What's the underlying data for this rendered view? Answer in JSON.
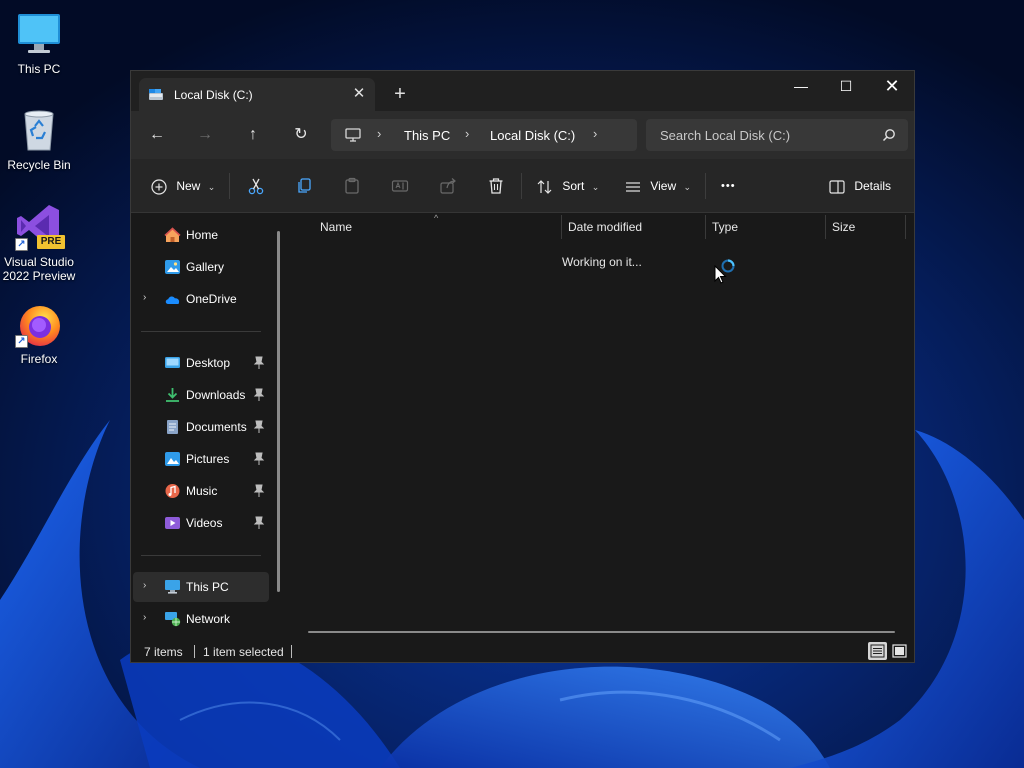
{
  "desktop": {
    "icons": [
      {
        "label": "This PC",
        "icon": "monitor-icon"
      },
      {
        "label": "Recycle Bin",
        "icon": "recycle-bin-icon"
      },
      {
        "label": "Visual Studio 2022 Preview",
        "icon": "visual-studio-icon",
        "badge": "PRE"
      },
      {
        "label": "Firefox",
        "icon": "firefox-icon"
      }
    ]
  },
  "window": {
    "tab": {
      "title": "Local Disk (C:)",
      "close": "✕",
      "new_tab": "+"
    },
    "controls": {
      "minimize": "—",
      "maximize": "☐",
      "close": "✕"
    },
    "nav": {
      "back": "←",
      "forward": "→",
      "up": "↑",
      "refresh": "↻",
      "breadcrumb": [
        "This PC",
        "Local Disk (C:)"
      ],
      "sep": "›",
      "search_placeholder": "Search Local Disk (C:)"
    },
    "toolbar": {
      "new_label": "New",
      "sort_label": "Sort",
      "view_label": "View",
      "more_label": "•••",
      "details_label": "Details",
      "chevron": "⌄"
    },
    "sidebar": {
      "top_items": [
        {
          "label": "Home",
          "icon": "home-icon"
        },
        {
          "label": "Gallery",
          "icon": "gallery-icon"
        },
        {
          "label": "OneDrive",
          "icon": "cloud-icon",
          "expander": "›"
        }
      ],
      "pinned_items": [
        {
          "label": "Desktop",
          "icon": "desktop-folder-icon"
        },
        {
          "label": "Downloads",
          "icon": "download-icon"
        },
        {
          "label": "Documents",
          "icon": "document-icon"
        },
        {
          "label": "Pictures",
          "icon": "pictures-icon"
        },
        {
          "label": "Music",
          "icon": "music-icon"
        },
        {
          "label": "Videos",
          "icon": "videos-icon"
        }
      ],
      "bottom_items": [
        {
          "label": "This PC",
          "icon": "monitor-icon",
          "expander": "›",
          "selected": true
        },
        {
          "label": "Network",
          "icon": "network-icon",
          "expander": "›"
        }
      ]
    },
    "columns": {
      "name": "Name",
      "date_modified": "Date modified",
      "type": "Type",
      "size": "Size",
      "sort_indicator": "^"
    },
    "content": {
      "status_message": "Working on it..."
    },
    "statusbar": {
      "item_count": "7 items",
      "selection": "1 item selected"
    }
  },
  "colors": {
    "window_bg": "#191919",
    "titlebar_bg": "#202020",
    "navbar_bg": "#2c2c2c",
    "accent": "#4cc2ff",
    "wallpaper_base": "#031237"
  }
}
